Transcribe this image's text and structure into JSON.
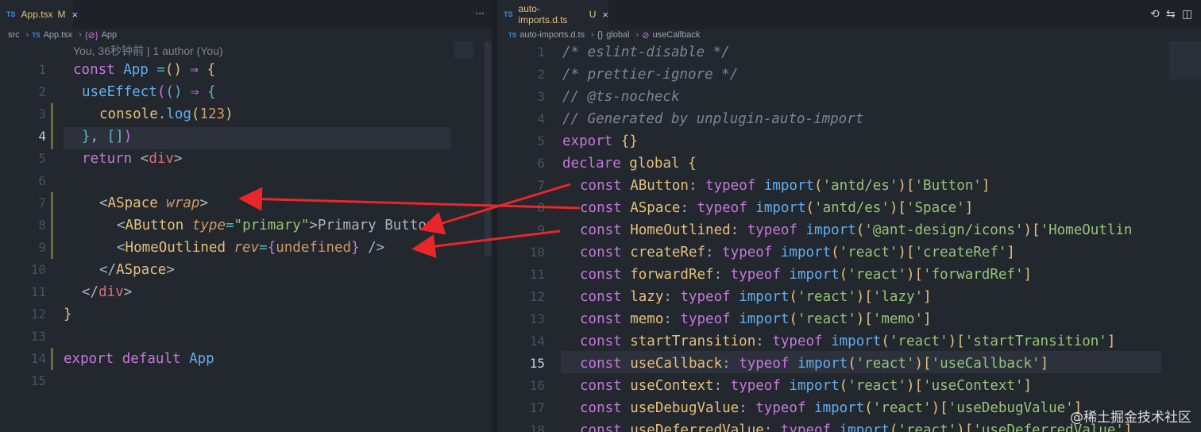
{
  "left": {
    "tab": {
      "badge": "TS",
      "name": "App.tsx",
      "status": "M",
      "close": "×",
      "more": "···"
    },
    "breadcrumbs": {
      "folder": "src",
      "file_badge": "TS",
      "file": "App.tsx",
      "symbol_icon": "{⊘}",
      "symbol": "App"
    },
    "blame": "You, 36秒钟前 | 1 author (You)",
    "line_numbers": [
      "1",
      "2",
      "3",
      "4",
      "5",
      "6",
      "7",
      "8",
      "9",
      "10",
      "11",
      "12",
      "13",
      "14",
      "15"
    ],
    "active_line": "4",
    "code": {
      "l1": [
        "const ",
        "App",
        " =",
        "(",
        ")",
        " ⇒ ",
        "{"
      ],
      "l2": [
        "useEffect",
        "(",
        "(",
        ")",
        " ⇒ ",
        "{"
      ],
      "l3": [
        "console",
        ".",
        "log",
        "(",
        "123",
        ")"
      ],
      "l4": [
        "}",
        ", ",
        "[",
        "]",
        ")"
      ],
      "l5": [
        "return ",
        "<",
        "div",
        ">"
      ],
      "l7": [
        "<",
        "ASpace",
        " wrap",
        ">"
      ],
      "l8": [
        "<",
        "AButton",
        " type",
        "=",
        "\"primary\"",
        ">",
        "Primary Button"
      ],
      "l9": [
        "<",
        "HomeOutlined",
        " rev",
        "=",
        "{",
        "undefined",
        "}",
        " />"
      ],
      "l10": [
        "</",
        "ASpace",
        ">"
      ],
      "l11": [
        "</",
        "div",
        ">"
      ],
      "l12": [
        "}"
      ],
      "l14": [
        "export ",
        "default ",
        "App"
      ]
    }
  },
  "right": {
    "tab": {
      "badge": "TS",
      "name": "auto-imports.d.ts",
      "status": "U",
      "close": "×"
    },
    "breadcrumbs": {
      "file_badge": "TS",
      "file": "auto-imports.d.ts",
      "ns_icon": "{}",
      "ns": "global",
      "symbol_icon": "⊘",
      "symbol": "useCallback"
    },
    "line_numbers": [
      "1",
      "2",
      "3",
      "4",
      "5",
      "6",
      "7",
      "8",
      "9",
      "10",
      "11",
      "12",
      "13",
      "14",
      "15",
      "16",
      "17",
      "18"
    ],
    "active_line": "15",
    "comments": [
      "/* eslint-disable */",
      "/* prettier-ignore */",
      "// @ts-nocheck",
      "// Generated by unplugin-auto-import"
    ],
    "l5": [
      "export ",
      "{",
      "}"
    ],
    "l6": [
      "declare ",
      "global ",
      "{"
    ],
    "decls": [
      {
        "name": "AButton",
        "module": "'antd/es'",
        "key": "'Button'"
      },
      {
        "name": "ASpace",
        "module": "'antd/es'",
        "key": "'Space'"
      },
      {
        "name": "HomeOutlined",
        "module": "'@ant-design/icons'",
        "key": "'HomeOutlin"
      },
      {
        "name": "createRef",
        "module": "'react'",
        "key": "'createRef'"
      },
      {
        "name": "forwardRef",
        "module": "'react'",
        "key": "'forwardRef'"
      },
      {
        "name": "lazy",
        "module": "'react'",
        "key": "'lazy'"
      },
      {
        "name": "memo",
        "module": "'react'",
        "key": "'memo'"
      },
      {
        "name": "startTransition",
        "module": "'react'",
        "key": "'startTransition'"
      },
      {
        "name": "useCallback",
        "module": "'react'",
        "key": "'useCallback'"
      },
      {
        "name": "useContext",
        "module": "'react'",
        "key": "'useContext'"
      },
      {
        "name": "useDebugValue",
        "module": "'react'",
        "key": "'useDebugValue'"
      },
      {
        "name": "useDeferredValue",
        "module": "'react'",
        "key": "'useDeferredValue'"
      }
    ],
    "kw_const": "const ",
    "kw_typeof": "typeof ",
    "kw_import": "import",
    "colon": ": ",
    "actions": {
      "history_icon": "⟲",
      "compare_icon": "⇆",
      "split_icon": "◫",
      "more_icon": "···"
    }
  },
  "watermark": "@稀土掘金技术社区",
  "colors": {
    "arrow": "#e8272b",
    "background": "#23272e",
    "keyword": "#c678dd",
    "function": "#61afef",
    "string": "#98c379"
  }
}
